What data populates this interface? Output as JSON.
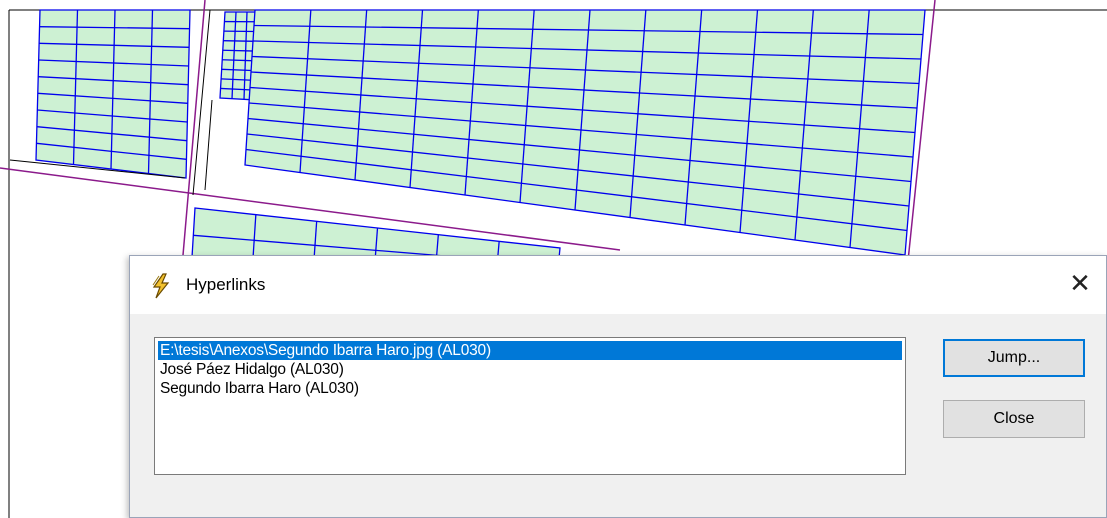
{
  "dialog": {
    "title": "Hyperlinks",
    "title_icon": "lightning-bolt-icon",
    "close_glyph": "✕",
    "items": [
      {
        "label": "E:\\tesis\\Anexos\\Segundo Ibarra Haro.jpg  (AL030)",
        "selected": true
      },
      {
        "label": "José Páez Hidalgo  (AL030)",
        "selected": false
      },
      {
        "label": "Segundo Ibarra Haro  (AL030)",
        "selected": false
      }
    ],
    "jump_label": "Jump...",
    "close_label": "Close"
  },
  "colors": {
    "parcel_fill": "#cdf1d3",
    "parcel_stroke": "#0000ee",
    "boundary_line": "#8b1a8b",
    "selection": "#0078d7",
    "dialog_bg": "#f0f0f0"
  }
}
